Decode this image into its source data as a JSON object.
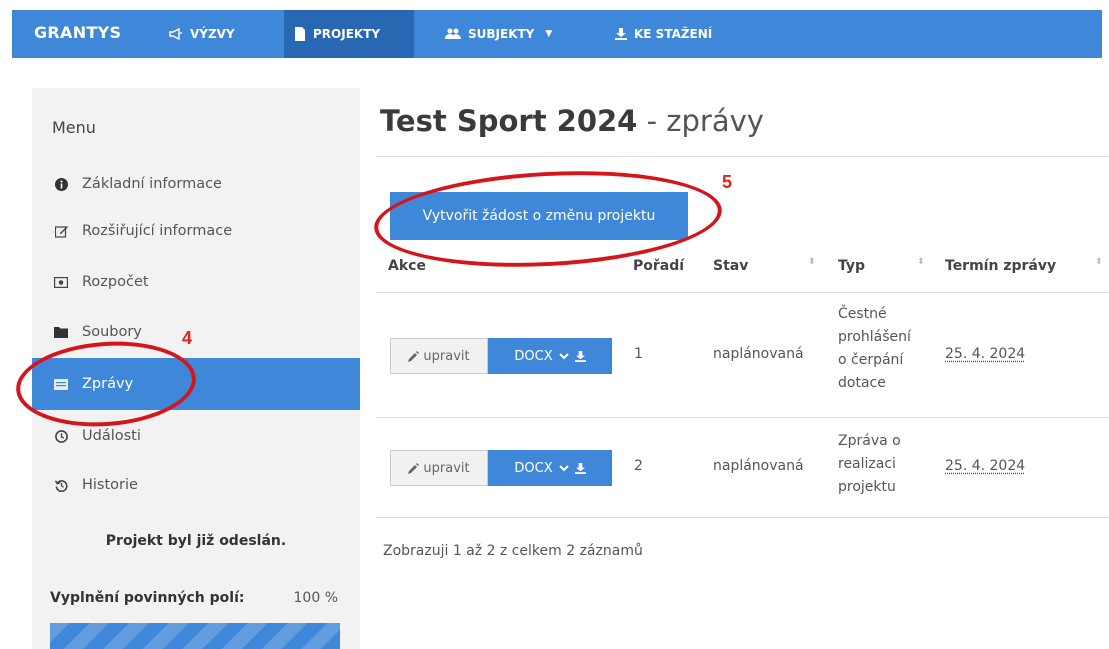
{
  "topbar": {
    "brand": "GRANTYS",
    "nav": [
      {
        "label": "VÝZVY",
        "icon": "bullhorn-icon"
      },
      {
        "label": "PROJEKTY",
        "icon": "document-icon",
        "active": true
      },
      {
        "label": "SUBJEKTY",
        "icon": "users-icon",
        "dropdown": true
      },
      {
        "label": "KE STAŽENÍ",
        "icon": "download-icon"
      }
    ]
  },
  "sidebar": {
    "title": "Menu",
    "items": [
      {
        "label": "Základní informace",
        "icon": "info-icon"
      },
      {
        "label": "Rozšiřující informace",
        "icon": "edit-icon"
      },
      {
        "label": "Rozpočet",
        "icon": "money-icon"
      },
      {
        "label": "Soubory",
        "icon": "folder-icon"
      },
      {
        "label": "Zprávy",
        "icon": "list-icon",
        "active": true
      },
      {
        "label": "Události",
        "icon": "clock-icon"
      },
      {
        "label": "Historie",
        "icon": "history-icon"
      }
    ],
    "status": "Projekt byl již odeslán.",
    "fill_label": "Vyplnění povinných polí:",
    "fill_value": "100 %",
    "fill_progress": 1.0
  },
  "main": {
    "title_bold": "Test Sport 2024",
    "title_rest": " - zprávy",
    "create_button": "Vytvořit žádost o změnu projektu",
    "columns": [
      "Akce",
      "Pořadí",
      "Stav",
      "Typ",
      "Termín zprávy"
    ],
    "rows": [
      {
        "edit": "upravit",
        "docx": "DOCX",
        "order": "1",
        "state": "naplánovaná",
        "type": "Čestné prohlášení o čerpání dotace",
        "type_lines": [
          "Čestné",
          "prohlášení",
          "o čerpání",
          "dotace"
        ],
        "date": "25. 4. 2024"
      },
      {
        "edit": "upravit",
        "docx": "DOCX",
        "order": "2",
        "state": "naplánovaná",
        "type": "Zpráva o realizaci projektu",
        "type_lines": [
          "Zpráva o",
          "realizaci",
          "projektu"
        ],
        "date": "25. 4. 2024"
      }
    ],
    "footer": "Zobrazuji 1 až 2 z celkem 2 záznamů"
  },
  "annotations": {
    "marker_4": "4",
    "marker_5": "5",
    "color": "#e2231a"
  },
  "colors": {
    "primary": "#3f87d8",
    "primary_dark": "#2867b1",
    "sidebar_bg": "#f2f2f2"
  }
}
